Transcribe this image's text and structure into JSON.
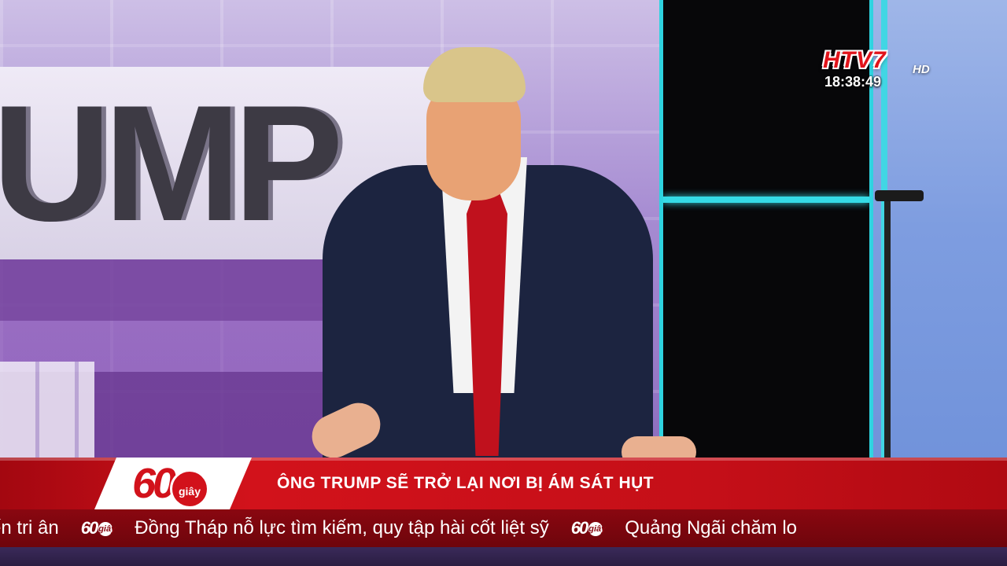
{
  "channel": {
    "logo_text": "HTV7",
    "logo_hd": "HD",
    "clock": "18:38:49",
    "accent_color": "#d2121b"
  },
  "scene": {
    "backdrop_letters": "UMP"
  },
  "lower_third": {
    "program_number": "60",
    "program_badge": "giây",
    "headline": "ÔNG TRUMP SẼ TRỞ LẠI NƠI BỊ ÁM SÁT HỤT",
    "ticker_items": [
      "ến tri ân",
      "Đồng Tháp nỗ lực tìm kiếm, quy tập hài cốt liệt sỹ",
      "Quảng Ngãi chăm lo"
    ],
    "ticker_separator_number": "60",
    "ticker_separator_badge": "giây",
    "ticker_separator_icon": "60-giay-logo-icon"
  }
}
